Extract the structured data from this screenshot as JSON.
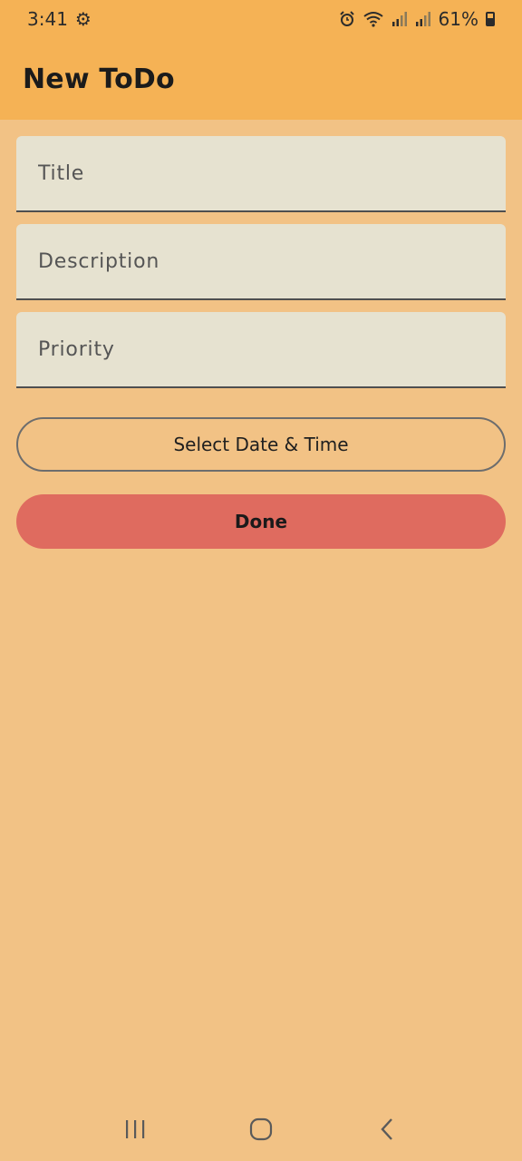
{
  "status_bar": {
    "time": "3:41",
    "battery_percent": "61%"
  },
  "app_bar": {
    "title": "New ToDo"
  },
  "form": {
    "title_placeholder": "Title",
    "description_placeholder": "Description",
    "priority_placeholder": "Priority",
    "date_time_button": "Select Date & Time",
    "done_button": "Done"
  },
  "colors": {
    "app_bar": "#f5b255",
    "background": "#f2c285",
    "field_fill": "#e6e2d0",
    "done_button": "#df6b5f"
  },
  "icons": {
    "status_left": [
      "settings-gear-icon"
    ],
    "status_right": [
      "alarm-icon",
      "wifi-icon",
      "signal-icon",
      "signal-icon-2",
      "battery-icon"
    ],
    "nav": [
      "recents-icon",
      "home-icon",
      "back-icon"
    ]
  }
}
